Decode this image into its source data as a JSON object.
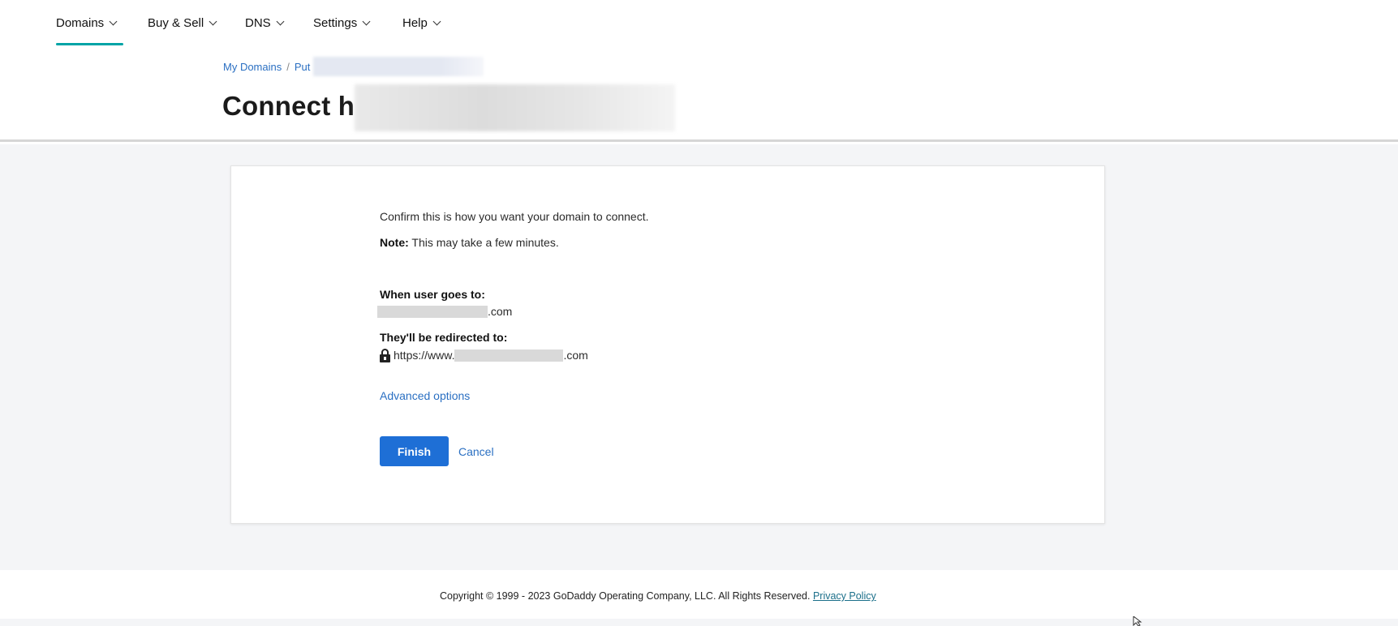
{
  "nav": {
    "items": [
      {
        "label": "Domains",
        "icon": "chevron-down-icon"
      },
      {
        "label": "Buy & Sell",
        "icon": "chevron-down-icon"
      },
      {
        "label": "DNS",
        "icon": "chevron-down-icon"
      },
      {
        "label": "Settings",
        "icon": "chevron-down-icon"
      },
      {
        "label": "Help",
        "icon": "chevron-down-icon"
      }
    ],
    "active_index": 0,
    "accent_color": "#00a4a6"
  },
  "breadcrumb": {
    "items": [
      "My Domains",
      "Put"
    ],
    "separator": "/"
  },
  "page": {
    "title": "Connect h"
  },
  "card": {
    "intro": "Confirm this is how you want your domain to connect.",
    "note_label": "Note:",
    "note_text": " This may take a few minutes.",
    "from_label": "When user goes to:",
    "from_suffix": ".com",
    "to_label": "They'll be redirected to:",
    "to_prefix": "https://www.",
    "to_suffix": ".com",
    "advanced_label": "Advanced options",
    "finish_label": "Finish",
    "cancel_label": "Cancel",
    "primary_color": "#1e6fd6",
    "link_color": "#2a6fc2"
  },
  "footer": {
    "copyright": "Copyright © 1999 - 2023 GoDaddy Operating Company, LLC. All Rights Reserved.",
    "privacy_label": "Privacy Policy"
  }
}
